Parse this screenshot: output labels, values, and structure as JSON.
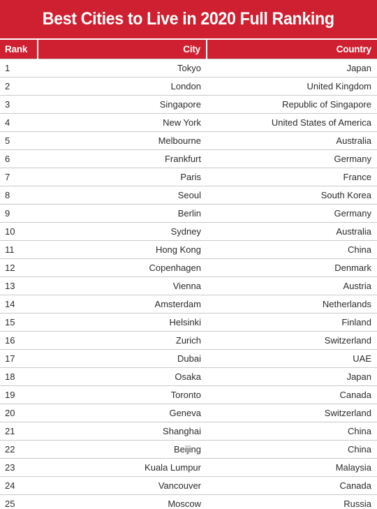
{
  "header": {
    "title": "Best Cities to Live in 2020 Full Ranking",
    "background_color": "#ce2030",
    "text_color": "#ffffff"
  },
  "table": {
    "columns": [
      {
        "key": "rank",
        "label": "Rank",
        "align": "left"
      },
      {
        "key": "city",
        "label": "City",
        "align": "right"
      },
      {
        "key": "country",
        "label": "Country",
        "align": "right"
      }
    ],
    "header_background": "#ce2030",
    "header_text_color": "#ffffff",
    "row_divider_color": "#c9c9c9",
    "row_text_color": "#2b2b2b",
    "rows": [
      {
        "rank": "1",
        "city": "Tokyo",
        "country": "Japan"
      },
      {
        "rank": "2",
        "city": "London",
        "country": "United Kingdom"
      },
      {
        "rank": "3",
        "city": "Singapore",
        "country": "Republic of Singapore"
      },
      {
        "rank": "4",
        "city": "New York",
        "country": "United States of America"
      },
      {
        "rank": "5",
        "city": "Melbourne",
        "country": "Australia"
      },
      {
        "rank": "6",
        "city": "Frankfurt",
        "country": "Germany"
      },
      {
        "rank": "7",
        "city": "Paris",
        "country": "France"
      },
      {
        "rank": "8",
        "city": "Seoul",
        "country": "South Korea"
      },
      {
        "rank": "9",
        "city": "Berlin",
        "country": "Germany"
      },
      {
        "rank": "10",
        "city": "Sydney",
        "country": "Australia"
      },
      {
        "rank": "11",
        "city": "Hong Kong",
        "country": "China"
      },
      {
        "rank": "12",
        "city": "Copenhagen",
        "country": "Denmark"
      },
      {
        "rank": "13",
        "city": "Vienna",
        "country": "Austria"
      },
      {
        "rank": "14",
        "city": "Amsterdam",
        "country": "Netherlands"
      },
      {
        "rank": "15",
        "city": "Helsinki",
        "country": "Finland"
      },
      {
        "rank": "16",
        "city": "Zurich",
        "country": "Switzerland"
      },
      {
        "rank": "17",
        "city": "Dubai",
        "country": "UAE"
      },
      {
        "rank": "18",
        "city": "Osaka",
        "country": "Japan"
      },
      {
        "rank": "19",
        "city": "Toronto",
        "country": "Canada"
      },
      {
        "rank": "20",
        "city": "Geneva",
        "country": "Switzerland"
      },
      {
        "rank": "21",
        "city": "Shanghai",
        "country": "China"
      },
      {
        "rank": "22",
        "city": "Beijing",
        "country": "China"
      },
      {
        "rank": "23",
        "city": "Kuala Lumpur",
        "country": "Malaysia"
      },
      {
        "rank": "24",
        "city": "Vancouver",
        "country": "Canada"
      },
      {
        "rank": "25",
        "city": "Moscow",
        "country": "Russia"
      }
    ]
  }
}
